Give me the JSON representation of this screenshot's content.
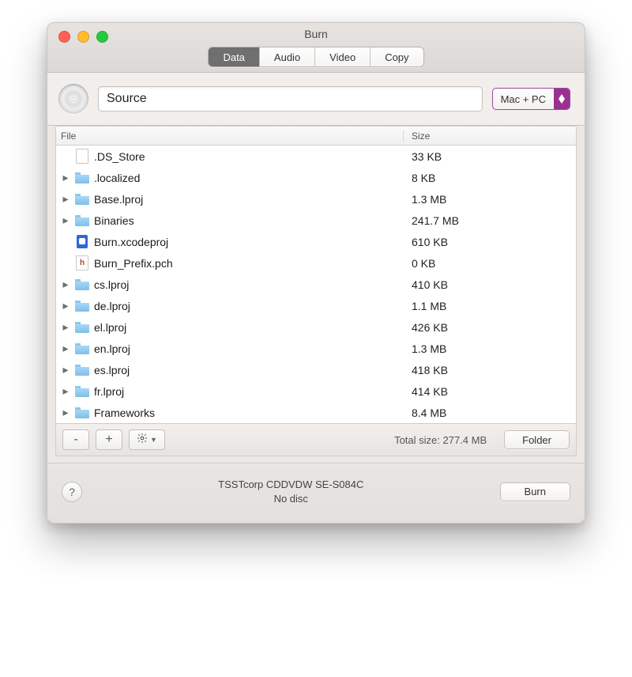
{
  "window": {
    "title": "Burn"
  },
  "tabs": [
    {
      "label": "Data",
      "active": true
    },
    {
      "label": "Audio",
      "active": false
    },
    {
      "label": "Video",
      "active": false
    },
    {
      "label": "Copy",
      "active": false
    }
  ],
  "source": {
    "value": "Source",
    "format": "Mac + PC"
  },
  "columns": {
    "file": "File",
    "size": "Size"
  },
  "files": [
    {
      "name": ".DS_Store",
      "size": "33 KB",
      "kind": "file-blank",
      "expandable": false
    },
    {
      "name": ".localized",
      "size": "8 KB",
      "kind": "folder",
      "expandable": true
    },
    {
      "name": "Base.lproj",
      "size": "1.3 MB",
      "kind": "folder",
      "expandable": true
    },
    {
      "name": "Binaries",
      "size": "241.7 MB",
      "kind": "folder",
      "expandable": true
    },
    {
      "name": "Burn.xcodeproj",
      "size": "610 KB",
      "kind": "file-blue",
      "expandable": false
    },
    {
      "name": "Burn_Prefix.pch",
      "size": "0 KB",
      "kind": "file-h",
      "expandable": false
    },
    {
      "name": "cs.lproj",
      "size": "410 KB",
      "kind": "folder",
      "expandable": true
    },
    {
      "name": "de.lproj",
      "size": "1.1 MB",
      "kind": "folder",
      "expandable": true
    },
    {
      "name": "el.lproj",
      "size": "426 KB",
      "kind": "folder",
      "expandable": true
    },
    {
      "name": "en.lproj",
      "size": "1.3 MB",
      "kind": "folder",
      "expandable": true
    },
    {
      "name": "es.lproj",
      "size": "418 KB",
      "kind": "folder",
      "expandable": true
    },
    {
      "name": "fr.lproj",
      "size": "414 KB",
      "kind": "folder",
      "expandable": true
    },
    {
      "name": "Frameworks",
      "size": "8.4 MB",
      "kind": "folder",
      "expandable": true
    }
  ],
  "footer": {
    "total_prefix": "Total size: ",
    "total_value": "277.4 MB",
    "folder_button": "Folder"
  },
  "drive": {
    "name": "TSSTcorp CDDVDW SE-S084C",
    "status": "No disc",
    "burn_button": "Burn"
  },
  "help_label": "?"
}
